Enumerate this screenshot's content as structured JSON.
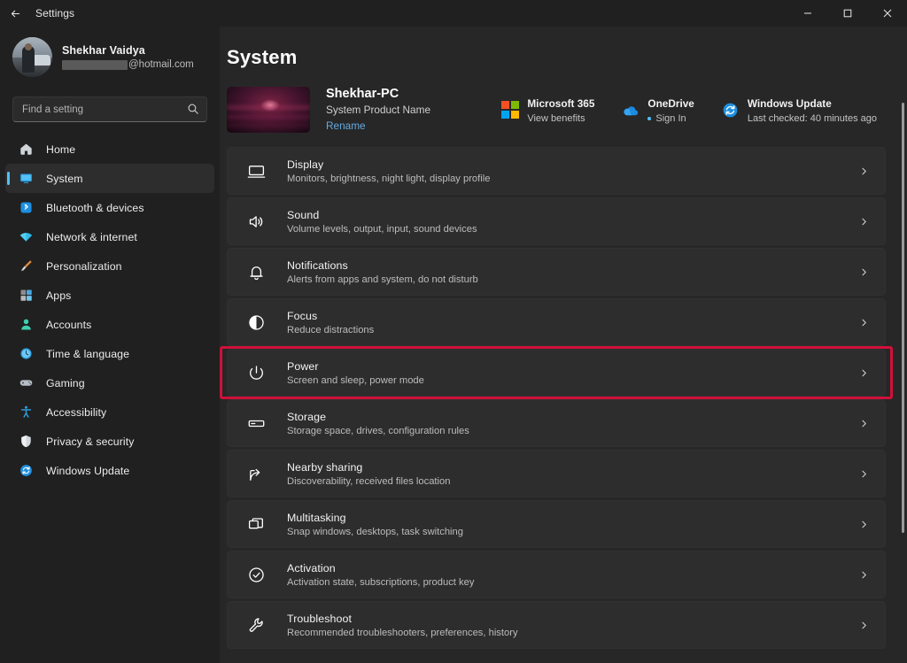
{
  "window": {
    "title": "Settings",
    "back_icon": "back-arrow-icon",
    "minimize": "minimize-icon",
    "maximize": "maximize-icon",
    "close": "close-icon"
  },
  "accent_color": "#4cc2ff",
  "highlight_color": "#d0103a",
  "sidebar": {
    "profile": {
      "name": "Shekhar Vaidya",
      "email_suffix": "@hotmail.com",
      "email_redacted": true,
      "avatar": "user-avatar"
    },
    "search": {
      "placeholder": "Find a setting",
      "value": "",
      "icon": "search-icon"
    },
    "items": [
      {
        "label": "Home",
        "icon": "home-icon",
        "active": false
      },
      {
        "label": "System",
        "icon": "system-icon",
        "active": true
      },
      {
        "label": "Bluetooth & devices",
        "icon": "bluetooth-icon",
        "active": false
      },
      {
        "label": "Network & internet",
        "icon": "wifi-icon",
        "active": false
      },
      {
        "label": "Personalization",
        "icon": "paintbrush-icon",
        "active": false
      },
      {
        "label": "Apps",
        "icon": "apps-icon",
        "active": false
      },
      {
        "label": "Accounts",
        "icon": "account-icon",
        "active": false
      },
      {
        "label": "Time & language",
        "icon": "clock-icon",
        "active": false
      },
      {
        "label": "Gaming",
        "icon": "gamepad-icon",
        "active": false
      },
      {
        "label": "Accessibility",
        "icon": "accessibility-icon",
        "active": false
      },
      {
        "label": "Privacy & security",
        "icon": "shield-icon",
        "active": false
      },
      {
        "label": "Windows Update",
        "icon": "update-icon",
        "active": false
      }
    ]
  },
  "main": {
    "page_title": "System",
    "device": {
      "name": "Shekhar-PC",
      "product": "System Product Name",
      "rename_label": "Rename",
      "thumbnail": "desktop-wallpaper-thumbnail"
    },
    "services": [
      {
        "title": "Microsoft 365",
        "sub": "View benefits",
        "icon": "microsoft-365-icon",
        "dot": false
      },
      {
        "title": "OneDrive",
        "sub": "Sign In",
        "icon": "onedrive-icon",
        "dot": true
      },
      {
        "title": "Windows Update",
        "sub": "Last checked: 40 minutes ago",
        "icon": "windows-update-icon",
        "dot": false
      }
    ],
    "rows": [
      {
        "title": "Display",
        "sub": "Monitors, brightness, night light, display profile",
        "icon": "display-icon",
        "highlighted": false
      },
      {
        "title": "Sound",
        "sub": "Volume levels, output, input, sound devices",
        "icon": "sound-icon",
        "highlighted": false
      },
      {
        "title": "Notifications",
        "sub": "Alerts from apps and system, do not disturb",
        "icon": "bell-icon",
        "highlighted": false
      },
      {
        "title": "Focus",
        "sub": "Reduce distractions",
        "icon": "focus-icon",
        "highlighted": false
      },
      {
        "title": "Power",
        "sub": "Screen and sleep, power mode",
        "icon": "power-icon",
        "highlighted": true
      },
      {
        "title": "Storage",
        "sub": "Storage space, drives, configuration rules",
        "icon": "storage-icon",
        "highlighted": false
      },
      {
        "title": "Nearby sharing",
        "sub": "Discoverability, received files location",
        "icon": "nearby-sharing-icon",
        "highlighted": false
      },
      {
        "title": "Multitasking",
        "sub": "Snap windows, desktops, task switching",
        "icon": "multitasking-icon",
        "highlighted": false
      },
      {
        "title": "Activation",
        "sub": "Activation state, subscriptions, product key",
        "icon": "activation-icon",
        "highlighted": false
      },
      {
        "title": "Troubleshoot",
        "sub": "Recommended troubleshooters, preferences, history",
        "icon": "troubleshoot-icon",
        "highlighted": false
      }
    ],
    "chevron_icon": "chevron-right-icon"
  }
}
